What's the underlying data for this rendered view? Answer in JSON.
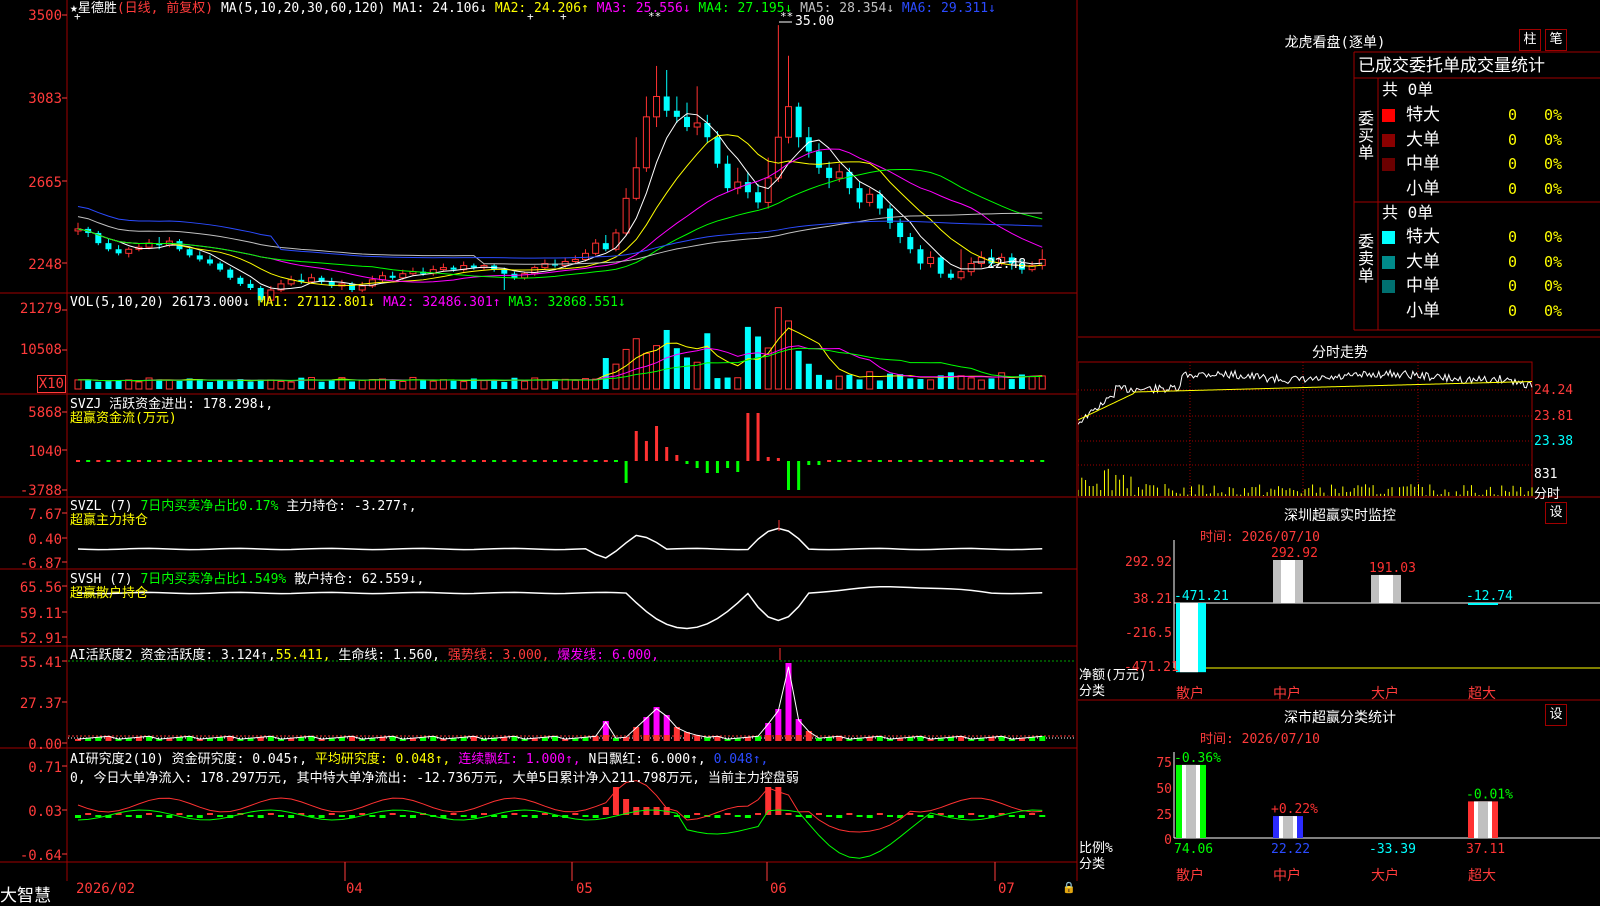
{
  "stock": {
    "title": "★星德胜",
    "mode": "(日线, 前复权)"
  },
  "ma_header": {
    "prefix": "MA(5,10,20,30,60,120)",
    "ma1": "MA1: 24.106↓",
    "ma2": "MA2: 24.206↑",
    "ma3": "MA3: 25.556↓",
    "ma4": "MA4: 27.195↓",
    "ma5": "MA5: 28.354↓",
    "ma6": "MA6: 29.311↓"
  },
  "price_axis": [
    "3500",
    "3083",
    "2665",
    "2248"
  ],
  "annotations": {
    "high": "35.00",
    "low": "22.48"
  },
  "vol_header": {
    "prefix": "VOL(5,10,20)",
    "val": "26173.000↓",
    "ma1": "MA1: 27112.801↓",
    "ma2": "MA2: 32486.301↑",
    "ma3": "MA3: 32868.551↓"
  },
  "vol_axis": [
    "21279",
    "10508",
    "X10"
  ],
  "svzj": {
    "line1": "SVZJ  活跃资金进出: 178.298↓,",
    "line2": "超赢资金流(万元)",
    "axis": [
      "5868",
      "1040",
      "-3788"
    ]
  },
  "svzl": {
    "name": "SVZL (7)",
    "pct": "7日内买卖净占比0.17%",
    "hold": "主力持仓: -3.277↑,",
    "line2": "超赢主力持仓",
    "axis": [
      "7.67",
      "0.40",
      "-6.87"
    ]
  },
  "svsh": {
    "name": "SVSH (7)",
    "pct": "7日内买卖净占比1.549%",
    "hold": "散户持仓: 62.559↓,",
    "line2": "超赢散户持仓",
    "axis": [
      "65.56",
      "59.11",
      "52.91"
    ]
  },
  "ai_active": {
    "name": "AI活跃度2",
    "a": "资金活跃度: 3.124↑,",
    "b": "55.411,",
    "c": "生命线: 1.560,",
    "d": "强势线: 3.000,",
    "e": "爆发线: 6.000,",
    "axis": [
      "55.41",
      "27.37",
      "0.00"
    ]
  },
  "ai_research": {
    "name": "AI研究度2(10)",
    "a": "资金研究度: 0.045↑,",
    "b": "平均研究度: 0.048↑,",
    "c": "连续飘红: 1.000↑,",
    "d": "N日飘红: 6.000↑,",
    "e": "0.048↑,",
    "summary": "0, 今日大单净流入: 178.297万元, 其中特大单净流出: -12.736万元, 大单5日累计净入211.798万元, 当前主力控盘弱",
    "axis": [
      "0.71",
      "0.03",
      "-0.64"
    ]
  },
  "date_axis": {
    "d1": "2026/02",
    "d2": "04",
    "d3": "05",
    "d4": "06",
    "d5": "07"
  },
  "brand": "大智慧",
  "dragon_tiger": {
    "title": "龙虎看盘(逐单)",
    "btn_bar": "柱",
    "btn_pen": "笔",
    "header": "已成交委托单成交量统计",
    "buy_group": "委买单",
    "sell_group": "委卖单",
    "buy_total": "共 0单",
    "sell_total": "共 0单",
    "buy_rows": [
      {
        "label": "特大",
        "n": "0",
        "p": "0%",
        "color": "#ff0000"
      },
      {
        "label": "大单",
        "n": "0",
        "p": "0%",
        "color": "#8b0000"
      },
      {
        "label": "中单",
        "n": "0",
        "p": "0%",
        "color": "#6b0000"
      },
      {
        "label": "小单",
        "n": "0",
        "p": "0%",
        "color": ""
      }
    ],
    "sell_rows": [
      {
        "label": "特大",
        "n": "0",
        "p": "0%",
        "color": "#00ffff"
      },
      {
        "label": "大单",
        "n": "0",
        "p": "0%",
        "color": "#008b8b"
      },
      {
        "label": "中单",
        "n": "0",
        "p": "0%",
        "color": "#007070"
      },
      {
        "label": "小单",
        "n": "0",
        "p": "0%",
        "color": ""
      }
    ]
  },
  "timeshare": {
    "title": "分时走势",
    "axis": [
      "24.24",
      "23.81",
      "23.38"
    ],
    "vol": "831",
    "vol_label": "分时"
  },
  "monitor": {
    "title": "深圳超赢实时监控",
    "btn": "设",
    "time": "时间: 2026/07/10",
    "ylabel": "净额(万元)",
    "xlabel": "分类",
    "axis": [
      "292.92",
      "38.21",
      "-216.5",
      "-471.21"
    ],
    "categories": [
      "散户",
      "中户",
      "大户",
      "超大"
    ],
    "values": [
      -471.21,
      292.92,
      191.03,
      -12.74
    ],
    "value_labels": [
      "-471.21",
      "292.92",
      "191.03",
      "-12.74"
    ]
  },
  "stats": {
    "title": "深市超赢分类统计",
    "btn": "设",
    "time": "时间: 2026/07/10",
    "ylabel": "比例%",
    "xlabel": "分类",
    "axis": [
      "75",
      "50",
      "25",
      "0"
    ],
    "categories": [
      "散户",
      "中户",
      "大户",
      "超大"
    ],
    "bar_values": [
      74.06,
      22.22,
      0,
      37.11
    ],
    "top_labels": [
      "-0.36%",
      "+0.22%",
      "",
      "-0.01%"
    ],
    "bottom_labels": [
      "74.06",
      "22.22",
      "-33.39",
      "37.11"
    ]
  },
  "chart_data": {
    "type": "candlestick",
    "title": "星德胜 (日线, 前复权)",
    "xlabel": "",
    "ylabel": "",
    "ylim": [
      22.0,
      35.5
    ],
    "x_ticks": [
      "2026/02",
      "04",
      "05",
      "06",
      "07"
    ],
    "candles": [
      [
        24.9,
        25.0,
        25.3,
        24.7
      ],
      [
        25.0,
        24.8,
        25.1,
        24.6
      ],
      [
        24.8,
        24.3,
        24.9,
        24.2
      ],
      [
        24.3,
        24.0,
        24.5,
        23.9
      ],
      [
        24.0,
        23.8,
        24.2,
        23.7
      ],
      [
        23.8,
        24.0,
        24.1,
        23.6
      ],
      [
        24.0,
        24.1,
        24.3,
        23.9
      ],
      [
        24.1,
        24.3,
        24.5,
        24.0
      ],
      [
        24.3,
        24.2,
        24.6,
        24.0
      ],
      [
        24.2,
        24.4,
        24.6,
        24.1
      ],
      [
        24.4,
        24.0,
        24.5,
        23.9
      ],
      [
        24.0,
        23.7,
        24.1,
        23.6
      ],
      [
        23.7,
        23.5,
        23.9,
        23.4
      ],
      [
        23.5,
        23.3,
        23.7,
        23.2
      ],
      [
        23.3,
        23.0,
        23.4,
        22.9
      ],
      [
        23.0,
        22.6,
        23.1,
        22.5
      ],
      [
        22.6,
        22.3,
        22.7,
        22.2
      ],
      [
        22.3,
        22.1,
        22.5,
        22.0
      ],
      [
        22.1,
        21.5,
        22.2,
        21.4
      ],
      [
        21.5,
        22.0,
        22.2,
        21.4
      ],
      [
        22.0,
        22.3,
        22.5,
        21.9
      ],
      [
        22.3,
        22.5,
        22.7,
        22.2
      ],
      [
        22.5,
        22.4,
        22.8,
        22.3
      ],
      [
        22.4,
        22.6,
        22.8,
        22.3
      ],
      [
        22.6,
        22.4,
        22.7,
        22.3
      ],
      [
        22.4,
        22.2,
        22.6,
        22.1
      ],
      [
        22.2,
        22.3,
        22.5,
        22.0
      ],
      [
        22.3,
        22.0,
        22.4,
        21.9
      ],
      [
        22.0,
        22.2,
        22.4,
        21.9
      ],
      [
        22.2,
        22.5,
        22.7,
        22.1
      ],
      [
        22.5,
        22.7,
        22.9,
        22.4
      ],
      [
        22.7,
        22.6,
        22.9,
        22.5
      ],
      [
        22.6,
        22.8,
        23.0,
        22.5
      ],
      [
        22.8,
        22.9,
        23.1,
        22.7
      ],
      [
        22.9,
        22.8,
        23.1,
        22.7
      ],
      [
        22.8,
        23.0,
        23.2,
        22.7
      ],
      [
        23.0,
        23.1,
        23.3,
        22.9
      ],
      [
        23.1,
        23.0,
        23.2,
        22.9
      ],
      [
        23.0,
        23.2,
        23.4,
        22.9
      ],
      [
        23.2,
        23.1,
        23.3,
        23.0
      ],
      [
        23.1,
        23.2,
        23.3,
        23.0
      ],
      [
        23.2,
        23.0,
        23.3,
        22.9
      ],
      [
        23.0,
        22.8,
        23.1,
        22.0
      ],
      [
        22.8,
        22.6,
        22.9,
        22.5
      ],
      [
        22.6,
        22.8,
        22.9,
        22.5
      ],
      [
        22.8,
        23.1,
        23.2,
        22.7
      ],
      [
        23.1,
        23.3,
        23.5,
        23.0
      ],
      [
        23.3,
        23.2,
        23.5,
        23.1
      ],
      [
        23.2,
        23.4,
        23.6,
        23.1
      ],
      [
        23.4,
        23.5,
        23.7,
        23.3
      ],
      [
        23.5,
        23.8,
        24.0,
        23.4
      ],
      [
        23.8,
        24.3,
        24.5,
        23.7
      ],
      [
        24.3,
        24.0,
        24.7,
        23.9
      ],
      [
        24.0,
        24.8,
        25.0,
        23.9
      ],
      [
        24.8,
        26.5,
        27.0,
        24.7
      ],
      [
        26.5,
        28.0,
        29.5,
        26.4
      ],
      [
        28.0,
        30.5,
        31.5,
        27.8
      ],
      [
        30.5,
        31.5,
        33.0,
        30.0
      ],
      [
        31.5,
        30.8,
        32.8,
        30.5
      ],
      [
        30.8,
        30.5,
        31.5,
        30.2
      ],
      [
        30.5,
        30.0,
        31.2,
        29.8
      ],
      [
        30.0,
        30.2,
        32.0,
        29.6
      ],
      [
        30.2,
        29.5,
        30.6,
        29.2
      ],
      [
        29.5,
        28.2,
        29.8,
        28.0
      ],
      [
        28.2,
        27.0,
        28.6,
        26.8
      ],
      [
        27.0,
        27.3,
        28.0,
        26.7
      ],
      [
        27.3,
        26.8,
        27.8,
        26.5
      ],
      [
        26.8,
        26.3,
        27.2,
        26.0
      ],
      [
        26.3,
        27.5,
        28.5,
        26.0
      ],
      [
        27.5,
        29.5,
        35.0,
        27.3
      ],
      [
        29.5,
        31.0,
        33.5,
        29.2
      ],
      [
        31.0,
        29.5,
        31.2,
        29.0
      ],
      [
        29.5,
        28.8,
        30.0,
        28.5
      ],
      [
        28.8,
        28.0,
        29.2,
        27.7
      ],
      [
        28.0,
        27.5,
        28.3,
        27.0
      ],
      [
        27.5,
        27.8,
        28.2,
        27.3
      ],
      [
        27.8,
        27.0,
        28.0,
        26.7
      ],
      [
        27.0,
        26.3,
        27.3,
        26.0
      ],
      [
        26.3,
        26.7,
        27.0,
        26.1
      ],
      [
        26.7,
        26.0,
        26.9,
        25.7
      ],
      [
        26.0,
        25.3,
        26.2,
        25.0
      ],
      [
        25.3,
        24.6,
        25.5,
        24.3
      ],
      [
        24.6,
        24.0,
        24.8,
        23.8
      ],
      [
        24.0,
        23.3,
        24.2,
        23.0
      ],
      [
        23.3,
        23.6,
        23.9,
        23.1
      ],
      [
        23.6,
        22.8,
        23.7,
        22.6
      ],
      [
        22.8,
        22.6,
        23.0,
        22.5
      ],
      [
        22.6,
        22.9,
        24.0,
        22.48
      ],
      [
        22.9,
        23.3,
        23.6,
        22.7
      ],
      [
        23.3,
        23.6,
        23.9,
        23.1
      ],
      [
        23.6,
        23.3,
        24.0,
        23.1
      ],
      [
        23.3,
        23.6,
        23.8,
        23.2
      ],
      [
        23.6,
        23.3,
        23.8,
        23.0
      ],
      [
        23.3,
        23.0,
        23.5,
        22.8
      ],
      [
        23.0,
        23.2,
        23.4,
        22.9
      ],
      [
        23.2,
        23.5,
        24.0,
        23.0
      ]
    ]
  }
}
